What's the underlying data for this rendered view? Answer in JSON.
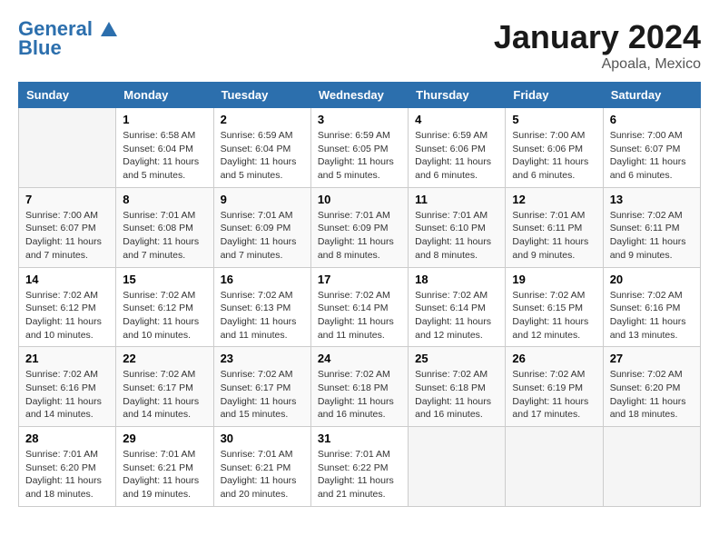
{
  "header": {
    "logo_line1": "General",
    "logo_line2": "Blue",
    "title": "January 2024",
    "subtitle": "Apoala, Mexico"
  },
  "columns": [
    "Sunday",
    "Monday",
    "Tuesday",
    "Wednesday",
    "Thursday",
    "Friday",
    "Saturday"
  ],
  "weeks": [
    [
      {
        "day": "",
        "sunrise": "",
        "sunset": "",
        "daylight": ""
      },
      {
        "day": "1",
        "sunrise": "Sunrise: 6:58 AM",
        "sunset": "Sunset: 6:04 PM",
        "daylight": "Daylight: 11 hours and 5 minutes."
      },
      {
        "day": "2",
        "sunrise": "Sunrise: 6:59 AM",
        "sunset": "Sunset: 6:04 PM",
        "daylight": "Daylight: 11 hours and 5 minutes."
      },
      {
        "day": "3",
        "sunrise": "Sunrise: 6:59 AM",
        "sunset": "Sunset: 6:05 PM",
        "daylight": "Daylight: 11 hours and 5 minutes."
      },
      {
        "day": "4",
        "sunrise": "Sunrise: 6:59 AM",
        "sunset": "Sunset: 6:06 PM",
        "daylight": "Daylight: 11 hours and 6 minutes."
      },
      {
        "day": "5",
        "sunrise": "Sunrise: 7:00 AM",
        "sunset": "Sunset: 6:06 PM",
        "daylight": "Daylight: 11 hours and 6 minutes."
      },
      {
        "day": "6",
        "sunrise": "Sunrise: 7:00 AM",
        "sunset": "Sunset: 6:07 PM",
        "daylight": "Daylight: 11 hours and 6 minutes."
      }
    ],
    [
      {
        "day": "7",
        "sunrise": "Sunrise: 7:00 AM",
        "sunset": "Sunset: 6:07 PM",
        "daylight": "Daylight: 11 hours and 7 minutes."
      },
      {
        "day": "8",
        "sunrise": "Sunrise: 7:01 AM",
        "sunset": "Sunset: 6:08 PM",
        "daylight": "Daylight: 11 hours and 7 minutes."
      },
      {
        "day": "9",
        "sunrise": "Sunrise: 7:01 AM",
        "sunset": "Sunset: 6:09 PM",
        "daylight": "Daylight: 11 hours and 7 minutes."
      },
      {
        "day": "10",
        "sunrise": "Sunrise: 7:01 AM",
        "sunset": "Sunset: 6:09 PM",
        "daylight": "Daylight: 11 hours and 8 minutes."
      },
      {
        "day": "11",
        "sunrise": "Sunrise: 7:01 AM",
        "sunset": "Sunset: 6:10 PM",
        "daylight": "Daylight: 11 hours and 8 minutes."
      },
      {
        "day": "12",
        "sunrise": "Sunrise: 7:01 AM",
        "sunset": "Sunset: 6:11 PM",
        "daylight": "Daylight: 11 hours and 9 minutes."
      },
      {
        "day": "13",
        "sunrise": "Sunrise: 7:02 AM",
        "sunset": "Sunset: 6:11 PM",
        "daylight": "Daylight: 11 hours and 9 minutes."
      }
    ],
    [
      {
        "day": "14",
        "sunrise": "Sunrise: 7:02 AM",
        "sunset": "Sunset: 6:12 PM",
        "daylight": "Daylight: 11 hours and 10 minutes."
      },
      {
        "day": "15",
        "sunrise": "Sunrise: 7:02 AM",
        "sunset": "Sunset: 6:12 PM",
        "daylight": "Daylight: 11 hours and 10 minutes."
      },
      {
        "day": "16",
        "sunrise": "Sunrise: 7:02 AM",
        "sunset": "Sunset: 6:13 PM",
        "daylight": "Daylight: 11 hours and 11 minutes."
      },
      {
        "day": "17",
        "sunrise": "Sunrise: 7:02 AM",
        "sunset": "Sunset: 6:14 PM",
        "daylight": "Daylight: 11 hours and 11 minutes."
      },
      {
        "day": "18",
        "sunrise": "Sunrise: 7:02 AM",
        "sunset": "Sunset: 6:14 PM",
        "daylight": "Daylight: 11 hours and 12 minutes."
      },
      {
        "day": "19",
        "sunrise": "Sunrise: 7:02 AM",
        "sunset": "Sunset: 6:15 PM",
        "daylight": "Daylight: 11 hours and 12 minutes."
      },
      {
        "day": "20",
        "sunrise": "Sunrise: 7:02 AM",
        "sunset": "Sunset: 6:16 PM",
        "daylight": "Daylight: 11 hours and 13 minutes."
      }
    ],
    [
      {
        "day": "21",
        "sunrise": "Sunrise: 7:02 AM",
        "sunset": "Sunset: 6:16 PM",
        "daylight": "Daylight: 11 hours and 14 minutes."
      },
      {
        "day": "22",
        "sunrise": "Sunrise: 7:02 AM",
        "sunset": "Sunset: 6:17 PM",
        "daylight": "Daylight: 11 hours and 14 minutes."
      },
      {
        "day": "23",
        "sunrise": "Sunrise: 7:02 AM",
        "sunset": "Sunset: 6:17 PM",
        "daylight": "Daylight: 11 hours and 15 minutes."
      },
      {
        "day": "24",
        "sunrise": "Sunrise: 7:02 AM",
        "sunset": "Sunset: 6:18 PM",
        "daylight": "Daylight: 11 hours and 16 minutes."
      },
      {
        "day": "25",
        "sunrise": "Sunrise: 7:02 AM",
        "sunset": "Sunset: 6:18 PM",
        "daylight": "Daylight: 11 hours and 16 minutes."
      },
      {
        "day": "26",
        "sunrise": "Sunrise: 7:02 AM",
        "sunset": "Sunset: 6:19 PM",
        "daylight": "Daylight: 11 hours and 17 minutes."
      },
      {
        "day": "27",
        "sunrise": "Sunrise: 7:02 AM",
        "sunset": "Sunset: 6:20 PM",
        "daylight": "Daylight: 11 hours and 18 minutes."
      }
    ],
    [
      {
        "day": "28",
        "sunrise": "Sunrise: 7:01 AM",
        "sunset": "Sunset: 6:20 PM",
        "daylight": "Daylight: 11 hours and 18 minutes."
      },
      {
        "day": "29",
        "sunrise": "Sunrise: 7:01 AM",
        "sunset": "Sunset: 6:21 PM",
        "daylight": "Daylight: 11 hours and 19 minutes."
      },
      {
        "day": "30",
        "sunrise": "Sunrise: 7:01 AM",
        "sunset": "Sunset: 6:21 PM",
        "daylight": "Daylight: 11 hours and 20 minutes."
      },
      {
        "day": "31",
        "sunrise": "Sunrise: 7:01 AM",
        "sunset": "Sunset: 6:22 PM",
        "daylight": "Daylight: 11 hours and 21 minutes."
      },
      {
        "day": "",
        "sunrise": "",
        "sunset": "",
        "daylight": ""
      },
      {
        "day": "",
        "sunrise": "",
        "sunset": "",
        "daylight": ""
      },
      {
        "day": "",
        "sunrise": "",
        "sunset": "",
        "daylight": ""
      }
    ]
  ]
}
